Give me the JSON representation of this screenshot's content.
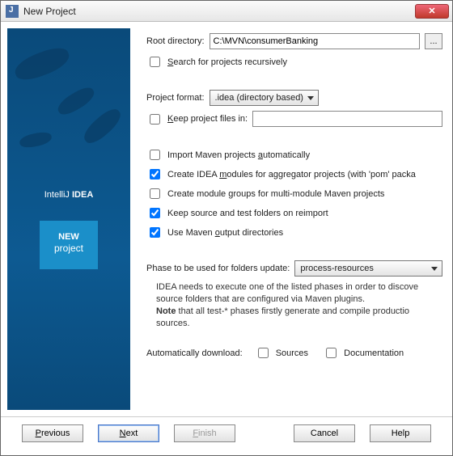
{
  "window_title": "New Project",
  "root": {
    "label": "Root directory:",
    "value": "C:\\MVN\\consumerBanking",
    "browse": "..."
  },
  "search_recursive": "Search for projects recursively",
  "project_format": {
    "label": "Project format:",
    "value": ".idea (directory based)"
  },
  "keep_files": {
    "label": "Keep project files in:",
    "value": ""
  },
  "import_auto": "Import Maven projects automatically",
  "create_idea": "Create IDEA modules for aggregator projects (with 'pom' packa",
  "create_groups": "Create module groups for multi-module Maven projects",
  "keep_source": "Keep source and test folders on reimport",
  "use_output": "Use Maven output directories",
  "phase": {
    "label": "Phase to be used for folders update:",
    "value": "process-resources"
  },
  "info1": "IDEA needs to execute one of the listed phases in order to discove source folders that are configured via Maven plugins.",
  "info2a": "Note",
  "info2b": " that all test-* phases firstly generate and compile productio sources.",
  "auto_dl": {
    "label": "Automatically download:",
    "s": "Sources",
    "d": "Documentation"
  },
  "brand1": "IntelliJ ",
  "brand2": "IDEA",
  "new1": "NEW",
  "new2": "project",
  "btn": {
    "prev": "Previous",
    "next": "Next",
    "finish": "Finish",
    "cancel": "Cancel",
    "help": "Help"
  }
}
